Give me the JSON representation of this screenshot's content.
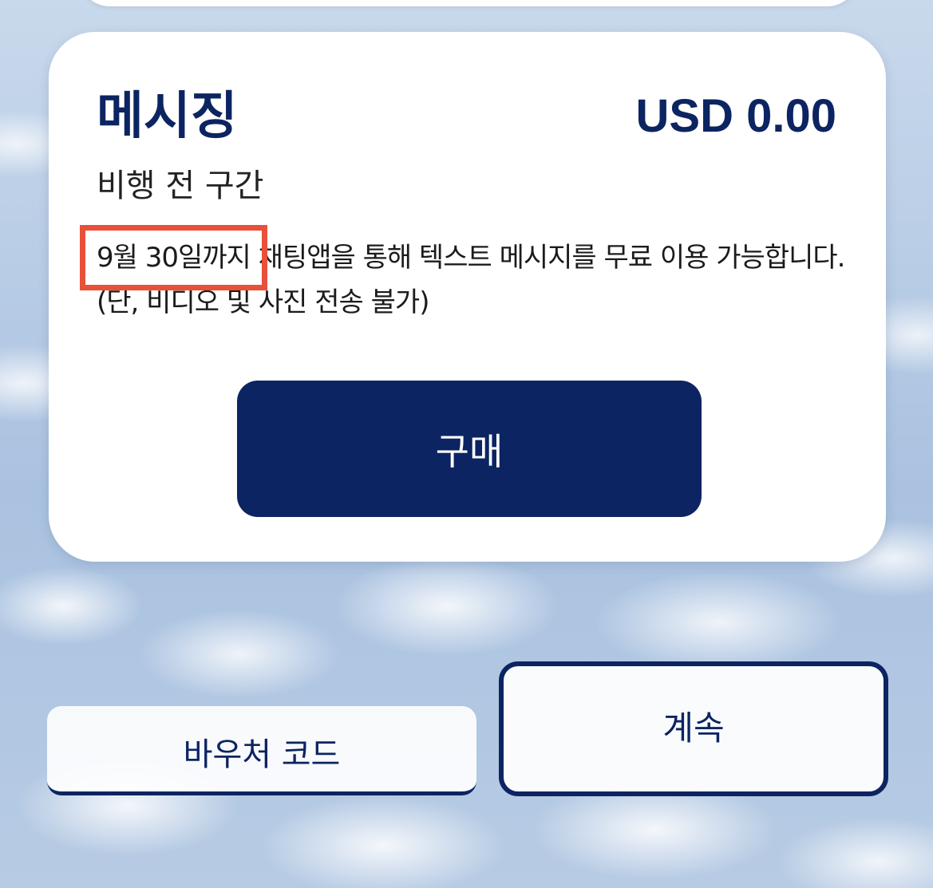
{
  "card": {
    "title": "메시징",
    "price": "USD 0.00",
    "subtitle": "비행 전 구간",
    "description_highlight": "9월 30일까지",
    "description_rest": " 채팅앱을 통해 텍스트 메시지를 무료 이용 가능합니다. (단, 비디오 및 사진 전송 불가)",
    "buy_label": "구매"
  },
  "actions": {
    "voucher_label": "바우처 코드",
    "continue_label": "계속"
  },
  "colors": {
    "navy": "#0c2461",
    "highlight_border": "#e8503a"
  }
}
